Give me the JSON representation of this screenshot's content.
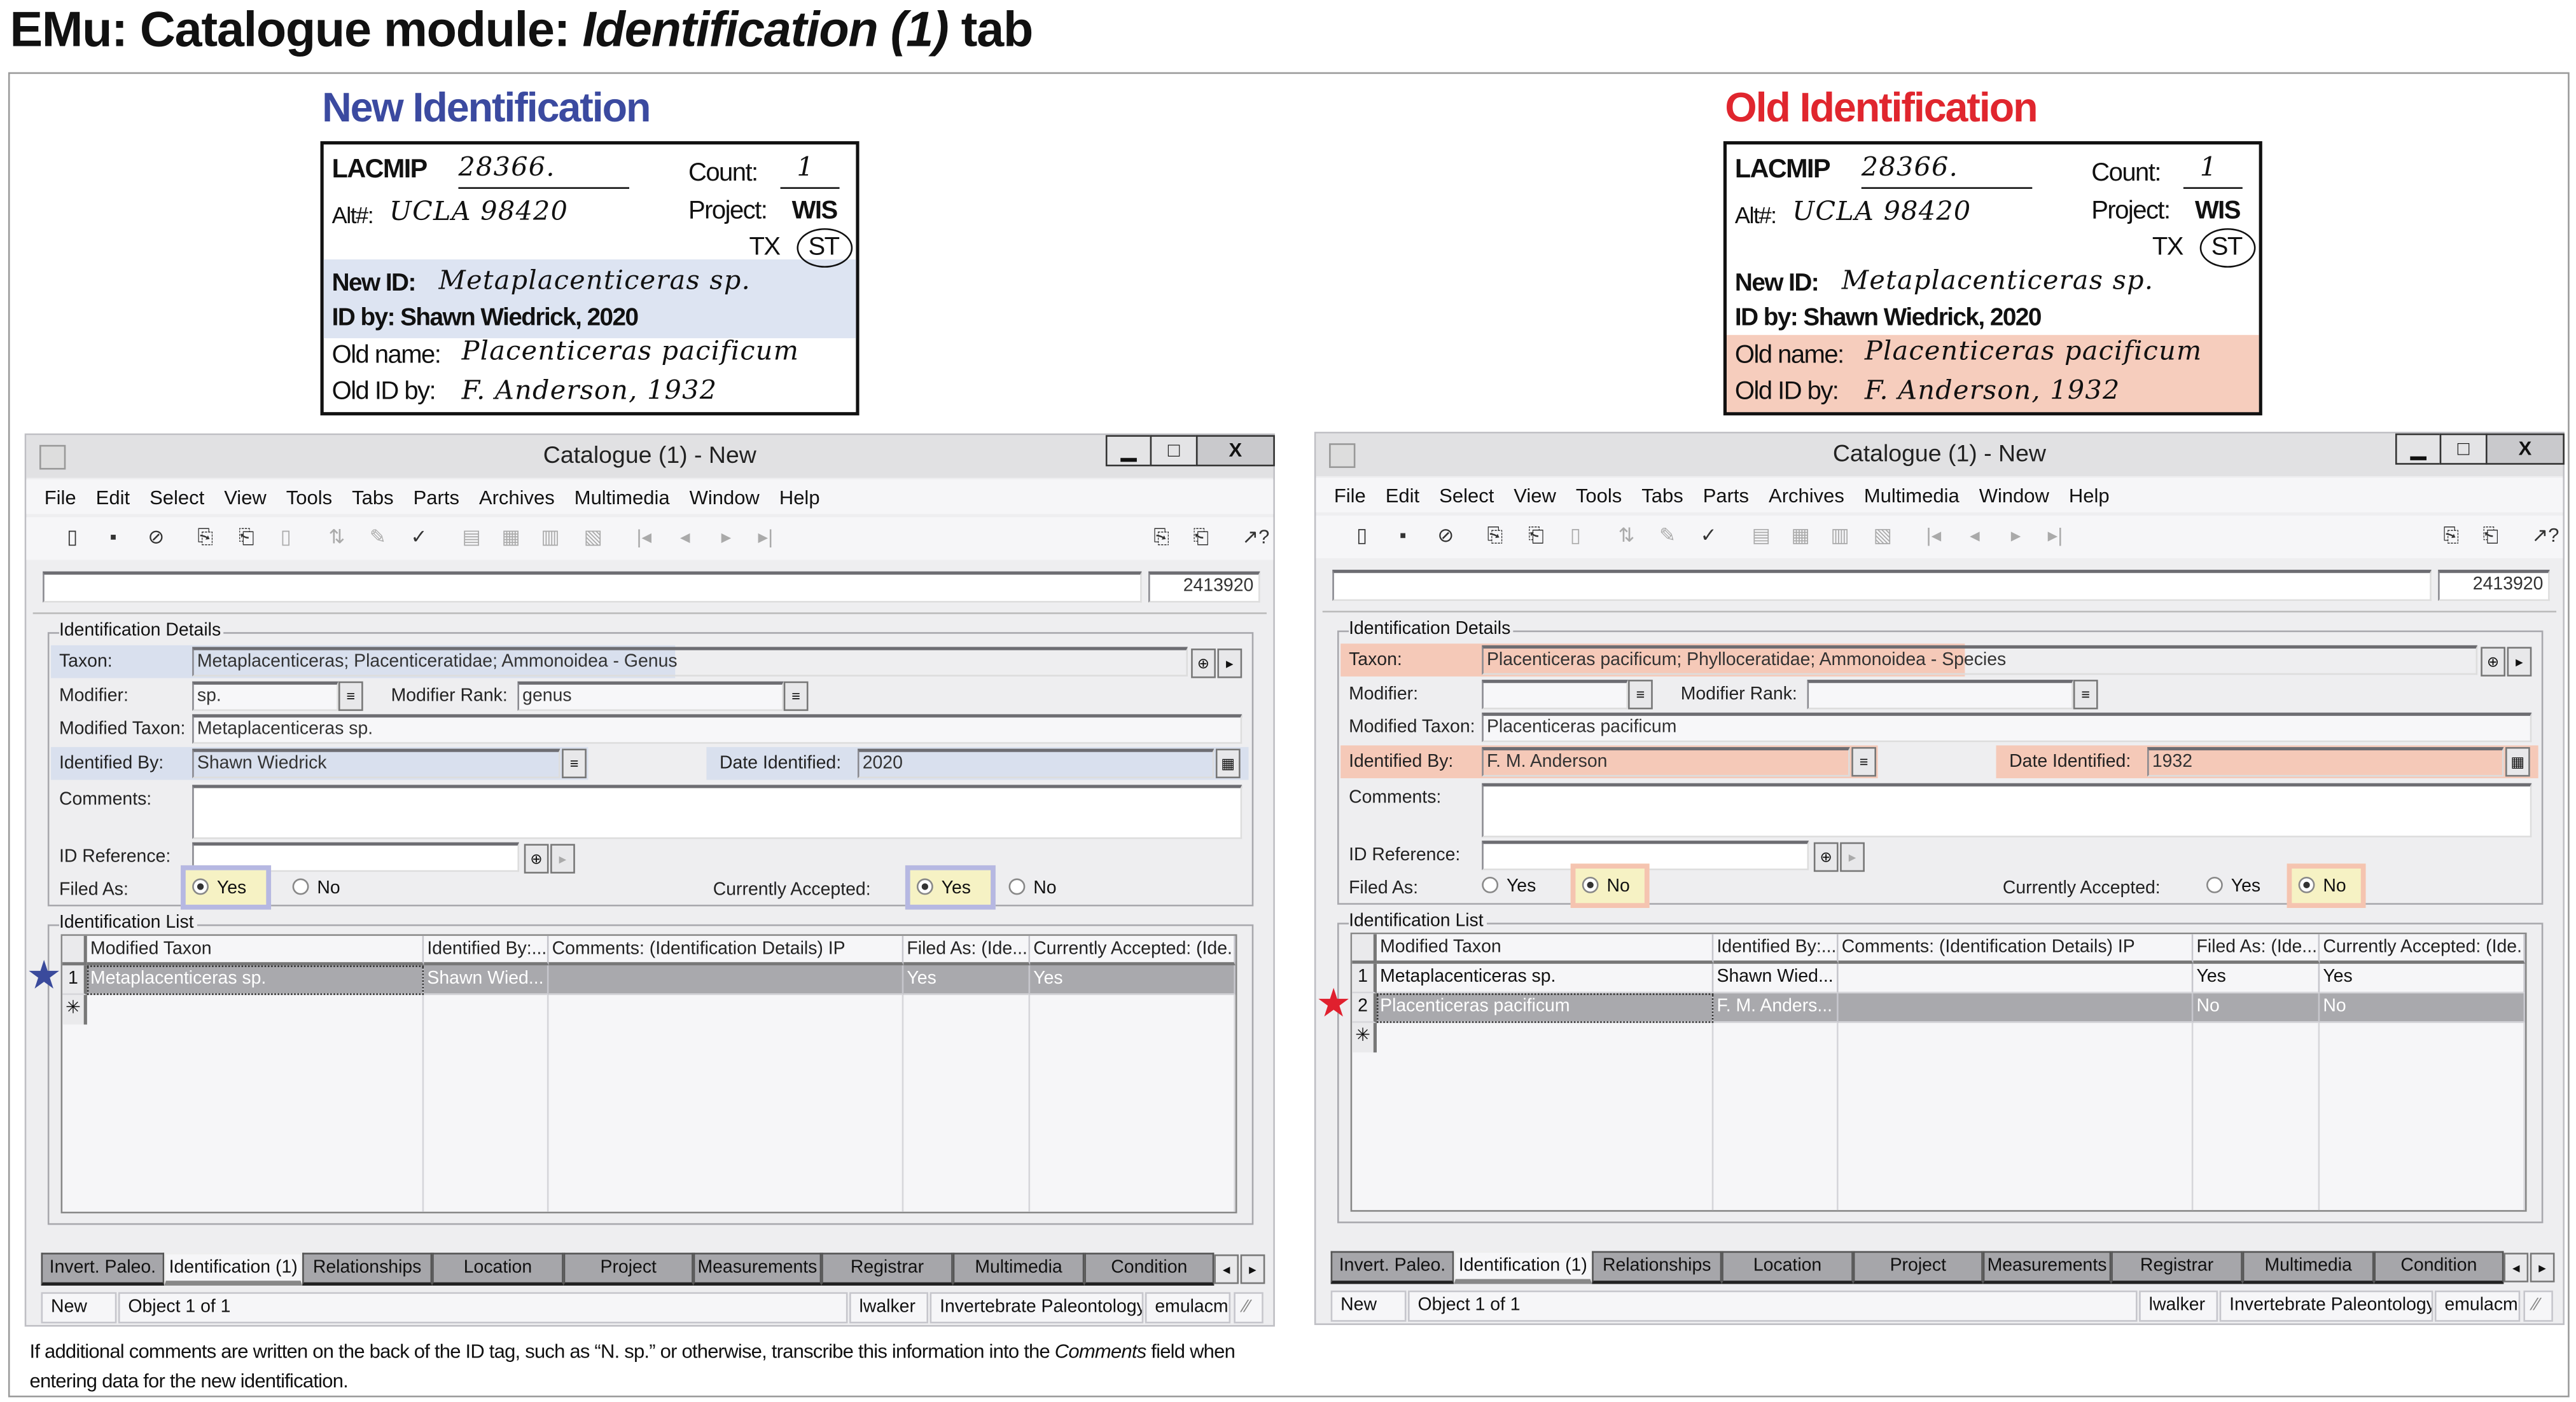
{
  "page_title": {
    "prefix": "EMu: Catalogue module: ",
    "italic": "Identification (1)",
    "suffix": " tab"
  },
  "footnote": {
    "before": "If additional comments are written on the back of the ID tag, such as “N. sp.” or otherwise, transcribe this information into the ",
    "italic": "Comments",
    "after": " field when entering data for the new identification."
  },
  "cards": [
    {
      "heading": "New Identification",
      "heading_color": "#3b4aa0",
      "highlight": "new",
      "highlight_color": "#dde4f2",
      "catalog_label": "LACMIP",
      "catalog_number": "28366.",
      "count_label": "Count:",
      "count": "1",
      "alt_label": "Alt#:",
      "alt_number": "UCLA 98420",
      "project_label": "Project:",
      "project": "WIS",
      "tx_label": "TX",
      "st_label": "ST",
      "new_id_label": "New ID:",
      "new_id": "Metaplacenticeras sp.",
      "id_by": "ID by: Shawn Wiedrick, 2020",
      "old_name_label": "Old name:",
      "old_name": "Placenticeras pacificum",
      "old_id_by_label": "Old ID by:",
      "old_id_by": "F. Anderson, 1932"
    },
    {
      "heading": "Old Identification",
      "heading_color": "#e0262e",
      "highlight": "old",
      "highlight_color": "#f6cdbd",
      "catalog_label": "LACMIP",
      "catalog_number": "28366.",
      "count_label": "Count:",
      "count": "1",
      "alt_label": "Alt#:",
      "alt_number": "UCLA 98420",
      "project_label": "Project:",
      "project": "WIS",
      "tx_label": "TX",
      "st_label": "ST",
      "new_id_label": "New ID:",
      "new_id": "Metaplacenticeras sp.",
      "id_by": "ID by: Shawn Wiedrick, 2020",
      "old_name_label": "Old name:",
      "old_name": "Placenticeras pacificum",
      "old_id_by_label": "Old ID by:",
      "old_id_by": "F. Anderson, 1932"
    }
  ],
  "labels": {
    "group_details": "Identification Details",
    "taxon": "Taxon:",
    "modifier": "Modifier:",
    "modifier_rank": "Modifier Rank:",
    "modified_taxon": "Modified Taxon:",
    "identified_by": "Identified By:",
    "date_identified": "Date Identified:",
    "comments": "Comments:",
    "id_reference": "ID Reference:",
    "filed_as": "Filed As:",
    "currently_accepted": "Currently Accepted:",
    "yes": "Yes",
    "no": "No",
    "group_list": "Identification List",
    "minimize": "▁",
    "maximize": "□",
    "close": "X"
  },
  "menu": [
    "File",
    "Edit",
    "Select",
    "View",
    "Tools",
    "Tabs",
    "Parts",
    "Archives",
    "Multimedia",
    "Window",
    "Help"
  ],
  "toolbar_icons": [
    "new-record-icon",
    "save-icon",
    "cancel-icon",
    "copy-icon",
    "paste-icon",
    "delete-icon",
    "sort-icon",
    "edit-icon",
    "spellcheck-icon",
    "list-view-icon",
    "grid-view-icon",
    "details-view-icon",
    "page-view-icon",
    "first-icon",
    "previous-icon",
    "next-icon",
    "last-icon",
    "attach-icon",
    "attach-copy-icon",
    "help-icon"
  ],
  "tabs": [
    "Invert. Paleo.",
    "Identification (1)",
    "Relationships",
    "Location",
    "Project",
    "Measurements",
    "Registrar",
    "Multimedia",
    "Condition"
  ],
  "active_tab": "Identification (1)",
  "grid_columns": [
    "Modified Taxon",
    "Identified By:...",
    "Comments: (Identification Details) IP",
    "Filed As: (Ide...",
    "Currently Accepted: (Ide..."
  ],
  "windows": [
    {
      "title": "Catalogue (1) - New",
      "record_number": "2413920",
      "highlight_color": "#d9e0ee",
      "radio_highlight_border": "#b6b8e2",
      "radio_highlight_fill": "#f6f2c4",
      "star_color": "#3a4a9c",
      "fields": {
        "taxon": "Metaplacenticeras; Placenticeratidae; Ammonoidea - Genus",
        "modifier": "sp.",
        "modifier_rank": "genus",
        "modified_taxon": "Metaplacenticeras sp.",
        "identified_by": "Shawn Wiedrick",
        "date_identified": "2020",
        "comments": "",
        "id_reference": ""
      },
      "filed_as": "Yes",
      "currently_accepted": "Yes",
      "rows": [
        [
          "1",
          "Metaplacenticeras sp.",
          "Shawn Wied...",
          "",
          "Yes",
          "Yes"
        ]
      ],
      "selected_row": 0,
      "status": [
        "New",
        "Object 1 of 1",
        "lwalker",
        "Invertebrate Paleontology",
        "emulacm"
      ]
    },
    {
      "title": "Catalogue (1) - New",
      "record_number": "2413920",
      "highlight_color": "#f5c9b8",
      "radio_highlight_border": "#f5c4b0",
      "radio_highlight_fill": "#f6f2c4",
      "star_color": "#e0202e",
      "fields": {
        "taxon": "Placenticeras pacificum; Phylloceratidae; Ammonoidea - Species",
        "modifier": "",
        "modifier_rank": "",
        "modified_taxon": "Placenticeras pacificum",
        "identified_by": "F. M. Anderson",
        "date_identified": "1932",
        "comments": "",
        "id_reference": ""
      },
      "filed_as": "No",
      "currently_accepted": "No",
      "rows": [
        [
          "1",
          "Metaplacenticeras sp.",
          "Shawn Wied...",
          "",
          "Yes",
          "Yes"
        ],
        [
          "2",
          "Placenticeras pacificum",
          "F. M. Anders...",
          "",
          "No",
          "No"
        ]
      ],
      "selected_row": 1,
      "status": [
        "New",
        "Object 1 of 1",
        "lwalker",
        "Invertebrate Paleontology",
        "emulacm"
      ]
    }
  ]
}
